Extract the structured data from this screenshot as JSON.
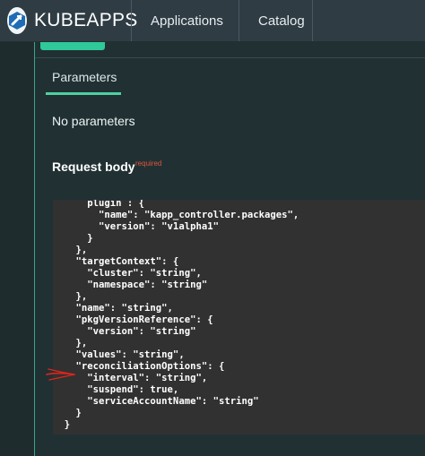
{
  "header": {
    "brand": "KUBEAPPS",
    "nav": [
      "Applications",
      "Catalog"
    ]
  },
  "panel": {
    "tab_label": "Parameters",
    "no_params_text": "No parameters",
    "request_body_label": "Request body",
    "required_flag": "required"
  },
  "code_lines": [
    "      plugin : {",
    "        \"name\": \"kapp_controller.packages\",",
    "        \"version\": \"v1alpha1\"",
    "      }",
    "    },",
    "    \"targetContext\": {",
    "      \"cluster\": \"string\",",
    "      \"namespace\": \"string\"",
    "    },",
    "    \"name\": \"string\",",
    "    \"pkgVersionReference\": {",
    "      \"version\": \"string\"",
    "    },",
    "    \"values\": \"string\",",
    "    \"reconciliationOptions\": {",
    "      \"interval\": \"string\",",
    "      \"suspend\": true,",
    "      \"serviceAccountName\": \"string\"",
    "    }",
    "  }"
  ],
  "colors": {
    "accent": "#4fcfa0",
    "required": "#e2533f",
    "annotation_arrow": "#e0241b"
  },
  "icons": {
    "brand_logo": "kubeapps-logo-icon",
    "annotation": "hand-drawn-arrow-icon"
  }
}
